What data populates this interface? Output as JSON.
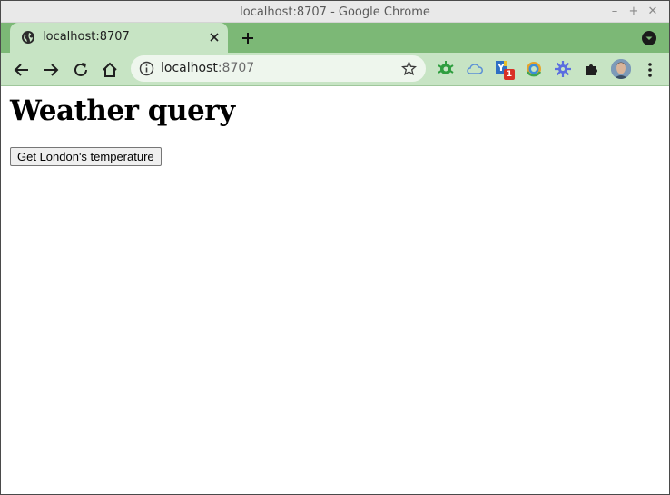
{
  "window": {
    "title": "localhost:8707 - Google Chrome"
  },
  "tab": {
    "title": "localhost:8707"
  },
  "omnibox": {
    "host": "localhost",
    "port": ":8707"
  },
  "extensions": {
    "badge_count": "1"
  },
  "page": {
    "heading": "Weather query",
    "button_label": "Get London's temperature"
  },
  "icons": [
    "minimize-icon",
    "maximize-icon",
    "close-icon",
    "globe-icon",
    "tab-close-icon",
    "new-tab-icon",
    "tab-search-icon",
    "back-icon",
    "forward-icon",
    "reload-icon",
    "home-icon",
    "info-icon",
    "bookmark-star-icon",
    "bug-extension-icon",
    "cloud-extension-icon",
    "y-extension-icon",
    "chrome-circle-extension-icon",
    "gear-extension-icon",
    "puzzle-icon",
    "profile-avatar",
    "menu-icon"
  ],
  "colors": {
    "tabstrip": "#7cb876",
    "toolbar": "#c7e4c4",
    "badge": "#d93025"
  }
}
